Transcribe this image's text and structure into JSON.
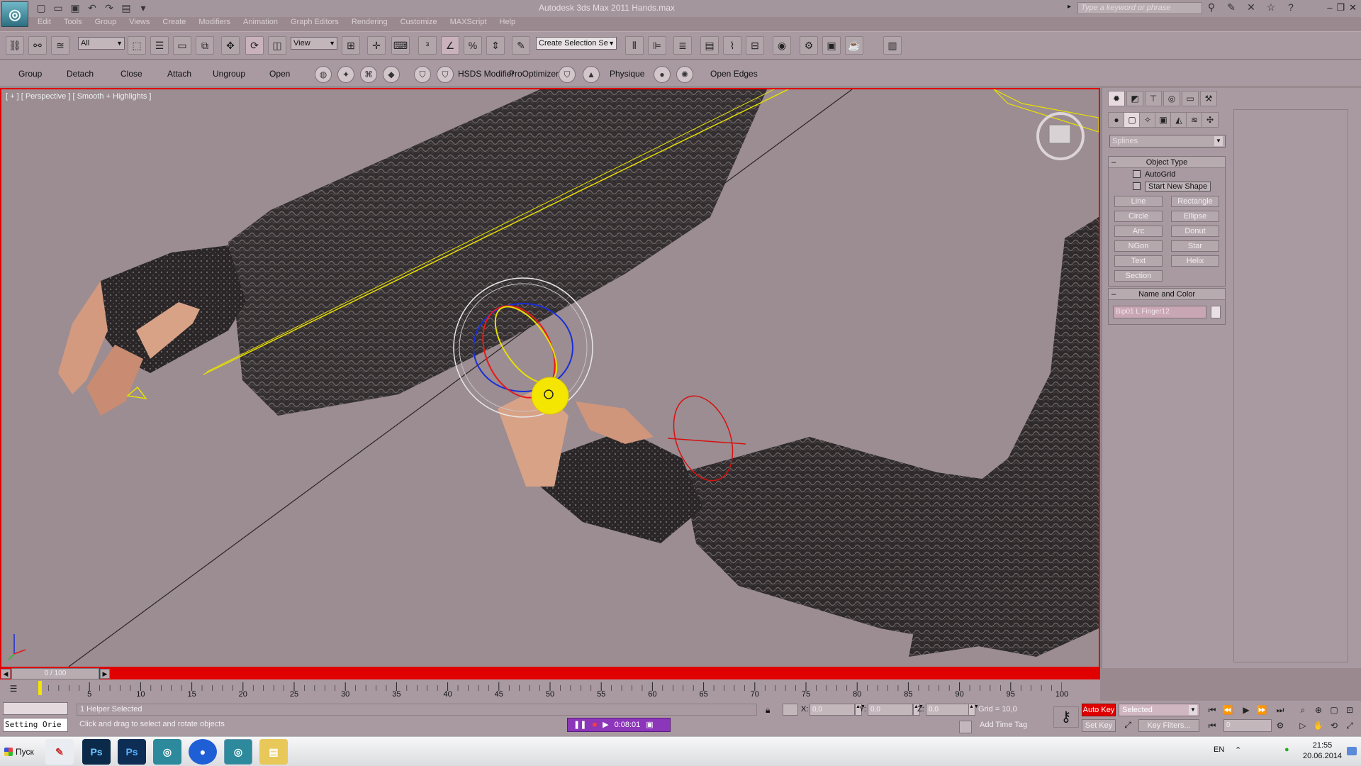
{
  "window": {
    "title": "Autodesk 3ds Max 2011   Hands.max",
    "search_placeholder": "Type a keyword or phrase"
  },
  "menu": [
    "Edit",
    "Tools",
    "Group",
    "Views",
    "Create",
    "Modifiers",
    "Animation",
    "Graph Editors",
    "Rendering",
    "Customize",
    "MAXScript",
    "Help"
  ],
  "toolbar1": {
    "filter_value": "All",
    "coord_value": "View",
    "selection_set_label": "Create Selection Se"
  },
  "toolbar2": {
    "labels": [
      "Group",
      "Detach",
      "Close",
      "Attach",
      "Ungroup",
      "Open"
    ],
    "hsds_label": "HSDS Modifier",
    "prooptimizer_label": "ProOptimizer",
    "physique_label": "Physique",
    "open_edges_label": "Open Edges"
  },
  "viewport": {
    "label": "[ + ] [ Perspective ] [ Smooth + Highlights ]"
  },
  "command_panel": {
    "category_value": "Splines",
    "object_type_title": "Object Type",
    "autogrid_label": "AutoGrid",
    "start_new_shape_label": "Start New Shape",
    "buttons": [
      "Line",
      "Rectangle",
      "Circle",
      "Ellipse",
      "Arc",
      "Donut",
      "NGon",
      "Star",
      "Text",
      "Helix",
      "Section"
    ],
    "name_color_title": "Name and Color",
    "name_value": "Bip01 L Finger12"
  },
  "time_slider": {
    "value": "0 / 100"
  },
  "trackbar": {
    "ticks": [
      "5",
      "10",
      "15",
      "20",
      "25",
      "30",
      "35",
      "40",
      "45",
      "50",
      "55",
      "60",
      "65",
      "70",
      "75",
      "80",
      "85",
      "90",
      "95",
      "100"
    ]
  },
  "status": {
    "maxscript_output": "Setting Orie",
    "selection_text": "1 Helper Selected",
    "prompt_text": "Click and drag to select and rotate objects",
    "recorder_time": "0:08:01",
    "x_label": "X:",
    "y_label": "Y:",
    "z_label": "Z:",
    "x_value": "0,0",
    "y_value": "0,0",
    "z_value": "0,0",
    "grid_text": "Grid = 10,0",
    "add_time_tag": "Add Time Tag",
    "auto_key": "Auto Key",
    "set_key": "Set Key",
    "selected_value": "Selected",
    "key_filters": "Key Filters...",
    "frame_value": "0"
  },
  "taskbar": {
    "start_label": "Пуск",
    "language": "EN",
    "time": "21:55",
    "date": "20.06.2014"
  },
  "colors": {
    "viewport_border": "#e00000",
    "auto_key_active": "#e00000",
    "recorder_purple": "#8c36b9"
  }
}
